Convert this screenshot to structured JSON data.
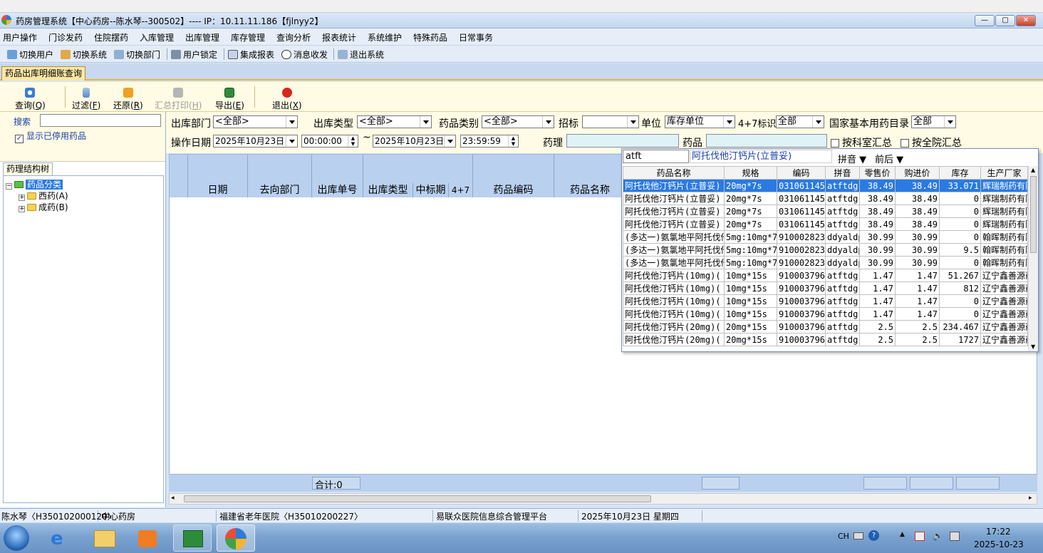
{
  "window": {
    "title": "药房管理系统【中心药房--陈水琴--300502】---- IP：10.11.11.186【fjlnyy2】"
  },
  "menu": [
    "用户操作",
    "门诊发药",
    "住院摆药",
    "入库管理",
    "出库管理",
    "库存管理",
    "查询分析",
    "报表统计",
    "系统维护",
    "特殊药品",
    "日常事务"
  ],
  "toolbar": {
    "switch_user": "切换用户",
    "switch_system": "切换系统",
    "switch_dept": "切换部门",
    "user_lock": "用户锁定",
    "integrated_report": "集成报表",
    "messages": "消息收发",
    "exit_system": "退出系统"
  },
  "tab": {
    "active": "药品出库明细账查询"
  },
  "actions": {
    "query": "查询(",
    "query_key": "Q",
    "filter": "过滤(",
    "filter_key": "F",
    "restore": "还原(",
    "restore_key": "R",
    "summary_print": "汇总打印(",
    "summary_print_key": "H",
    "export": "导出(",
    "export_key": "E",
    "exit": "退出(",
    "exit_key": "X",
    "close_paren": ")"
  },
  "left": {
    "search_label": "搜索",
    "show_disabled": "显示已停用药品",
    "tree_tab": "药理结构树",
    "tree_root": "药品分类",
    "tree_children": [
      "西药(A)",
      "成药(B)"
    ]
  },
  "filters": {
    "out_dept_label": "出库部门",
    "out_dept_value": "<全部>",
    "out_type_label": "出库类型",
    "out_type_value": "<全部>",
    "drug_cat_label": "药品类别",
    "drug_cat_value": "<全部>",
    "bid_label": "招标",
    "bid_value": "",
    "unit_label": "单位",
    "unit_value": "库存单位",
    "flag47_label": "4+7标识",
    "flag47_value": "全部",
    "national_label": "国家基本用药目录",
    "national_value": "全部",
    "op_date_label": "操作日期",
    "date_from": "2025年10月23日",
    "time_from": "00:00:00",
    "tilde": "~",
    "date_to": "2025年10月23日",
    "time_to": "23:59:59",
    "pharm_label": "药理",
    "drug_label": "药品",
    "by_dept_sum": "按科室汇总",
    "by_hospital_sum": "按全院汇总"
  },
  "grid": {
    "columns": [
      "日期",
      "去向部门",
      "出库单号",
      "出库类型",
      "中标期",
      "4+7",
      "药品编码",
      "药品名称"
    ],
    "total_label": "合计:0"
  },
  "popup": {
    "search_value": "atft",
    "selected_name": "阿托伐他汀钙片(立普妥)",
    "sort_by": "拼音",
    "sort_order": "前后",
    "columns": [
      "药品名称",
      "规格",
      "编码",
      "拼音",
      "零售价",
      "购进价",
      "库存",
      "生产厂家"
    ],
    "rows": [
      [
        "阿托伐他汀钙片(立普妥)",
        "20mg*7s",
        "031061145",
        "atftdg",
        "38.49",
        "38.49",
        "33.071",
        "辉瑞制药有限公司"
      ],
      [
        "阿托伐他汀钙片(立普妥)",
        "20mg*7s",
        "031061145",
        "atftdg",
        "38.49",
        "38.49",
        "0",
        "辉瑞制药有限公司"
      ],
      [
        "阿托伐他汀钙片(立普妥)",
        "20mg*7s",
        "031061145",
        "atftdg",
        "38.49",
        "38.49",
        "0",
        "辉瑞制药有限公司"
      ],
      [
        "阿托伐他汀钙片(立普妥)",
        "20mg*7s",
        "031061145",
        "atftdg",
        "38.49",
        "38.49",
        "0",
        "辉瑞制药有限公司"
      ],
      [
        "(多达一)氨氯地平阿托伐他汀钙片",
        "5mg:10mg*7",
        "910002823",
        "ddyaldp",
        "30.99",
        "30.99",
        "0",
        "翰晖制药有限公司"
      ],
      [
        "(多达一)氨氯地平阿托伐他汀钙片",
        "5mg:10mg*7",
        "910002823",
        "ddyaldp",
        "30.99",
        "30.99",
        "9.5",
        "翰晖制药有限公司"
      ],
      [
        "(多达一)氨氯地平阿托伐他汀钙片",
        "5mg:10mg*7",
        "910002823",
        "ddyaldp",
        "30.99",
        "30.99",
        "0",
        "翰晖制药有限公司"
      ],
      [
        "阿托伐他汀钙片(10mg)(",
        "10mg*15s",
        "910003796",
        "atftdg",
        "1.47",
        "1.47",
        "51.267",
        "辽宁鑫善源药业"
      ],
      [
        "阿托伐他汀钙片(10mg)(",
        "10mg*15s",
        "910003796",
        "atftdg",
        "1.47",
        "1.47",
        "812",
        "辽宁鑫善源药业"
      ],
      [
        "阿托伐他汀钙片(10mg)(",
        "10mg*15s",
        "910003796",
        "atftdg",
        "1.47",
        "1.47",
        "0",
        "辽宁鑫善源药业"
      ],
      [
        "阿托伐他汀钙片(10mg)(",
        "10mg*15s",
        "910003796",
        "atftdg",
        "1.47",
        "1.47",
        "0",
        "辽宁鑫善源药业"
      ],
      [
        "阿托伐他汀钙片(20mg)(",
        "20mg*15s",
        "910003796",
        "atftdg",
        "2.5",
        "2.5",
        "234.467",
        "辽宁鑫善源药业"
      ],
      [
        "阿托伐他汀钙片(20mg)(",
        "20mg*15s",
        "910003796",
        "atftdg",
        "2.5",
        "2.5",
        "1727",
        "辽宁鑫善源药业"
      ]
    ]
  },
  "status": {
    "user": "陈水琴〈H350102000120〉",
    "pharmacy": "中心药房",
    "hospital": "福建省老年医院〈H35010200227〉",
    "platform": "易联众医院信息综合管理平台",
    "date": "2025年10月23日 星期四"
  },
  "taskbar": {
    "lang": "CH",
    "time": "17:22",
    "date": "2025-10-23"
  },
  "colors": {
    "selected_row": "#2a7ae2",
    "grid_header": "#b9d0ef",
    "action_bar": "#fffbe4",
    "active_tab": "#fbe7a6"
  }
}
